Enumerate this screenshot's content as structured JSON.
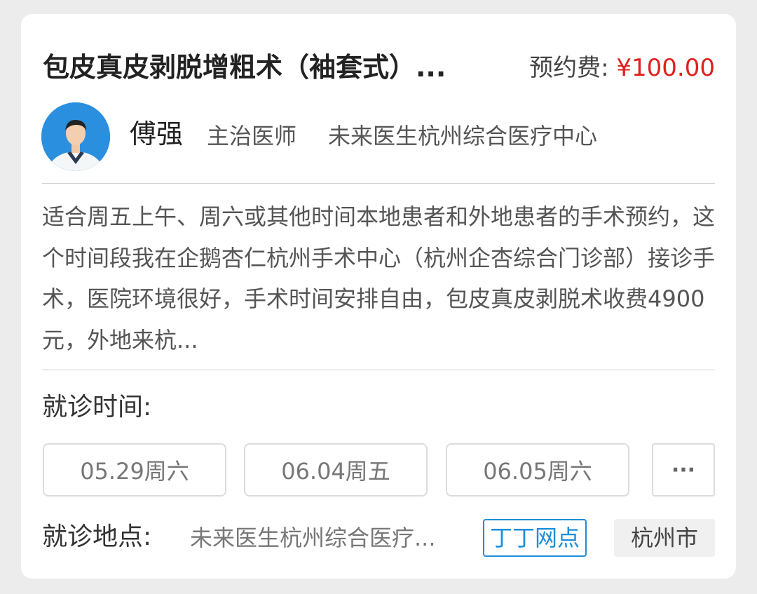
{
  "card": {
    "title": "包皮真皮剥脱增粗术（袖套式）...",
    "fee_label": "预约费: ",
    "fee_value": "¥100.00",
    "doctor": {
      "name": "傅强",
      "title": "主治医师",
      "hospital": "未来医生杭州综合医疗中心"
    },
    "description": "适合周五上午、周六或其他时间本地患者和外地患者的手术预约，这个时间段我在企鹅杏仁杭州手术中心（杭州企杏综合门诊部）接诊手术，医院环境很好，手术时间安排自由，包皮真皮剥脱术收费4900元，外地来杭...",
    "visit_time_label": "就诊时间:",
    "dates": [
      "05.29周六",
      "06.04周五",
      "06.05周六"
    ],
    "more_label": "···",
    "visit_place_label": "就诊地点:",
    "visit_place_value": "未来医生杭州综合医疗...",
    "tag_outline": "丁丁网点",
    "tag_city": "杭州市"
  },
  "colors": {
    "price": "#e0201e",
    "tag_blue": "#1a8fd8",
    "avatar_bg": "#2b8fe0"
  }
}
